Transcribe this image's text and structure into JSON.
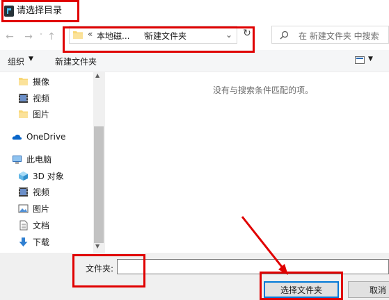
{
  "window": {
    "title": "请选择目录"
  },
  "nav": {
    "back_icon": "back-arrow-icon",
    "forward_icon": "forward-arrow-icon",
    "up_icon": "up-arrow-icon",
    "address": {
      "overflow": "«",
      "segment1": "本地磁...",
      "separator": "›",
      "segment2": "新建文件夹"
    },
    "refresh_icon": "refresh-icon",
    "search_placeholder": "在 新建文件夹 中搜索"
  },
  "toolbar": {
    "organize": "组织",
    "organize_arrow": "▼",
    "new_folder": "新建文件夹",
    "view_arrow": "▼"
  },
  "sidebar": {
    "items": [
      {
        "label": "摄像",
        "icon": "folder-icon"
      },
      {
        "label": "视频",
        "icon": "video-icon"
      },
      {
        "label": "图片",
        "icon": "folder-icon"
      },
      {
        "label": "OneDrive",
        "icon": "cloud-icon"
      },
      {
        "label": "此电脑",
        "icon": "computer-icon"
      },
      {
        "label": "3D 对象",
        "icon": "cube-icon"
      },
      {
        "label": "视频",
        "icon": "video-icon"
      },
      {
        "label": "图片",
        "icon": "picture-icon"
      },
      {
        "label": "文档",
        "icon": "document-icon"
      },
      {
        "label": "下载",
        "icon": "download-icon"
      }
    ]
  },
  "content": {
    "empty_message": "没有与搜索条件匹配的项。"
  },
  "footer": {
    "folder_label": "文件夹:",
    "folder_value": "",
    "select_button": "选择文件夹",
    "cancel_button": "取消"
  },
  "colors": {
    "highlight": "#e00000",
    "accent": "#0078d7",
    "folder": "#f8d775"
  }
}
